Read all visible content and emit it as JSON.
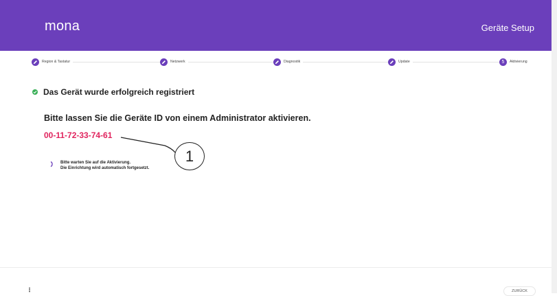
{
  "header": {
    "brand": "mona",
    "title": "Geräte Setup",
    "background_color": "#6b3fbb"
  },
  "stepper": {
    "steps": [
      {
        "label": "Region & Tastatur",
        "state": "completed",
        "icon": "pencil-icon"
      },
      {
        "label": "Netzwerk",
        "state": "completed",
        "icon": "pencil-icon"
      },
      {
        "label": "Diagnostik",
        "state": "completed",
        "icon": "pencil-icon"
      },
      {
        "label": "Update",
        "state": "completed",
        "icon": "pencil-icon"
      },
      {
        "label": "Aktivierung",
        "state": "active",
        "number": "5"
      }
    ]
  },
  "main": {
    "success_message": "Das Gerät wurde erfolgreich registriert",
    "success_icon": "check-icon",
    "success_color": "#3cb059",
    "instruction": "Bitte lassen Sie die Geräte ID von einem Administrator aktivieren.",
    "device_id": "00-11-72-33-74-61",
    "device_id_color": "#e0245e",
    "callout_number": "1",
    "wait_line1": "Bitte warten Sie auf die Aktivierung.",
    "wait_line2": "Die Einrichtung wird automatisch fortgesetzt."
  },
  "footer": {
    "more_icon": "more-vertical-icon",
    "back_label": "ZURÜCK"
  }
}
